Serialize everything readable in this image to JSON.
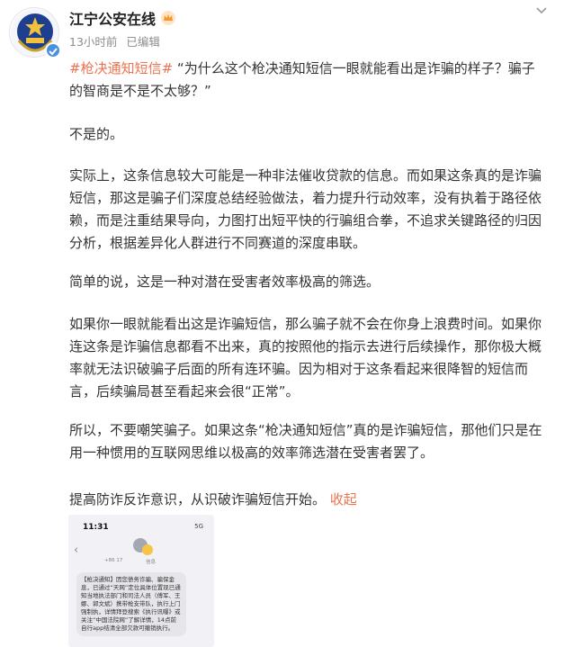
{
  "post": {
    "author_name": "江宁公安在线",
    "time_ago": "13小时前",
    "edited_label": "已编辑",
    "paragraphs": {
      "p1_topic": "#枪决通知短信#",
      "p1_text": "“为什么这个枪决通知短信一眼就能看出是诈骗的样子？骗子的智商是不是不太够？”",
      "p2": "不是的。",
      "p3": "实际上，这条信息较大可能是一种非法催收贷款的信息。而如果这条真的是诈骗短信，那这是骗子们深度总结经验做法，着力提升行动效率，没有执着于路径依赖，而是注重结果导向，力图打出短平快的行骗组合拳，不追求关键路径的归因分析，根据差异化人群进行不同赛道的深度串联。",
      "p4": "简单的说，这是一种对潜在受害者效率极高的筛选。",
      "p5": "如果你一眼就能看出这是诈骗短信，那么骗子就不会在你身上浪费时间。如果你连这条是诈骗信息都看不出来，真的按照他的指示去进行后续操作，那你极大概率就无法识破骗子后面的所有连环骗。因为相对于这条看起来很降智的短信而言，后续骗局甚至看起来会很“正常”。",
      "p6": "所以，不要嘲笑骗子。如果这条“枪决通知短信”真的是诈骗短信，那他们只是在用一种惯用的互联网思维以极高的效率筛选潜在受害者罢了。",
      "p7_text": "提高防诈反诈意识，从识破诈骗短信开始。",
      "p7_collapse": "收起"
    }
  },
  "screenshot": {
    "time": "11:31",
    "status": "5G",
    "number": "+86 17",
    "label": "信息",
    "sms_text": "【枪决通知】因您债务诈骗、骗保金息，已通过“天网”定位具体位置现已通知当地执法部门和司法人员（傅军、王娜、郭文斌）携带枪支带队，执行上门强制执，详情拜登搜索《执行讯曝》或关注“中国法院网”了解详情，14点前自行app结清全部欠款可撤销执行。"
  },
  "colors": {
    "accent": "#eb7350",
    "verify_badge": "#4a90e2",
    "text": "#333333",
    "meta": "#8c8c8c"
  },
  "icons": [
    "police-emblem-icon",
    "verified-icon",
    "crown-icon",
    "chevron-down-icon"
  ]
}
